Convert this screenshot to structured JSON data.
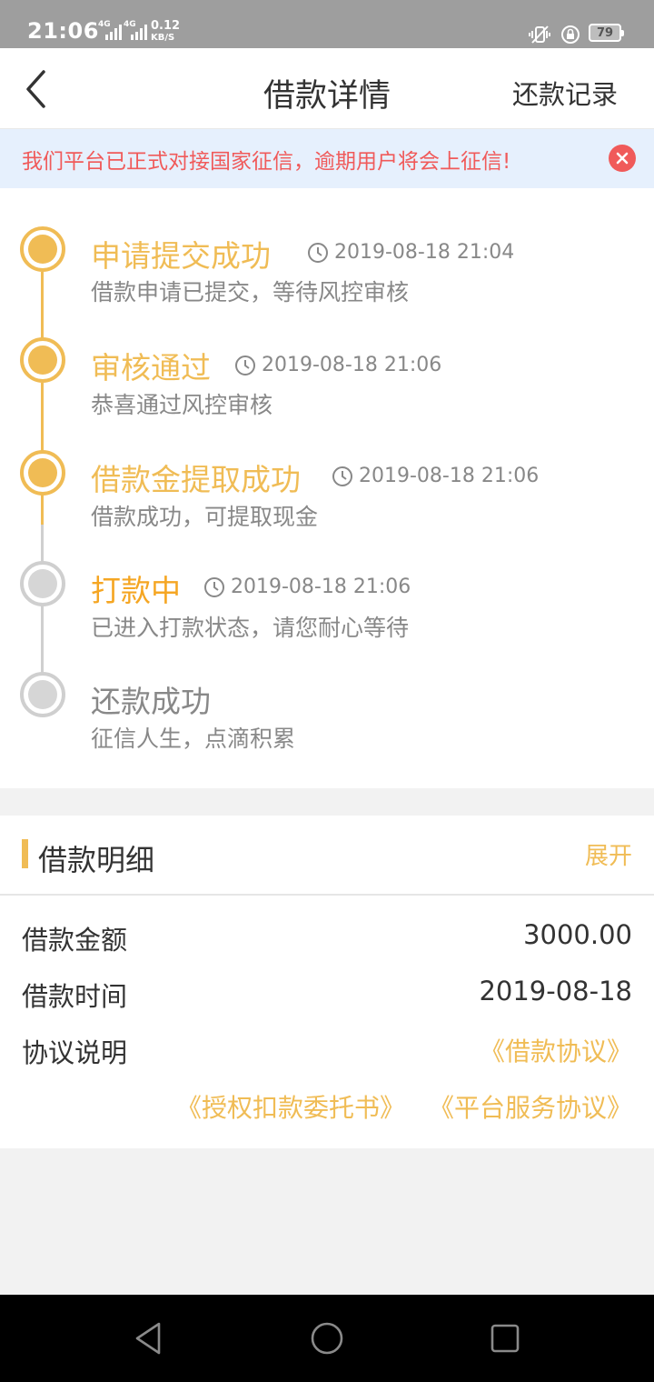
{
  "status_bar": {
    "time": "21:06",
    "network": "4G",
    "speed_value": "0.12",
    "speed_unit": "KB/S",
    "battery": "79"
  },
  "header": {
    "back_icon": "chevron-left-icon",
    "title": "借款详情",
    "right_action": "还款记录"
  },
  "notice": {
    "text": "我们平台已正式对接国家征信，逾期用户将会上征信!",
    "close_icon": "close-circle-icon",
    "color": "#f05a5a"
  },
  "timeline": {
    "steps": [
      {
        "title": "申请提交成功",
        "time": "2019-08-18 21:04",
        "desc": "借款申请已提交，等待风控审核",
        "state": "done"
      },
      {
        "title": "审核通过",
        "time": "2019-08-18 21:06",
        "desc": "恭喜通过风控审核",
        "state": "done"
      },
      {
        "title": "借款金提取成功",
        "time": "2019-08-18 21:06",
        "desc": "借款成功，可提取现金",
        "state": "done"
      },
      {
        "title": "打款中",
        "time": "2019-08-18 21:06",
        "desc": "已进入打款状态，请您耐心等待",
        "state": "current"
      },
      {
        "title": "还款成功",
        "time": "",
        "desc": "征信人生，点滴积累",
        "state": "pending"
      }
    ],
    "accent_color": "#f0bc55",
    "pending_color": "#cfcfcf"
  },
  "loan_detail": {
    "title": "借款明细",
    "expand_label": "展开",
    "amount_label": "借款金额",
    "amount_value": "3000.00",
    "date_label": "借款时间",
    "date_value": "2019-08-18",
    "agreement_label": "协议说明",
    "agreements": [
      "《借款协议》",
      "《授权扣款委托书》",
      "《平台服务协议》"
    ]
  },
  "nav_bar": {
    "back": "triangle-back-icon",
    "home": "circle-home-icon",
    "recents": "square-recents-icon"
  }
}
